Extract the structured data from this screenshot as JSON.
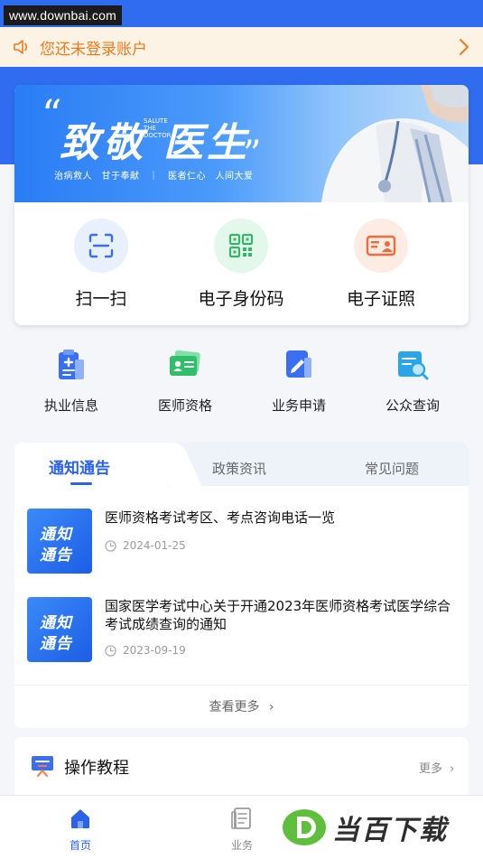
{
  "status": {
    "watermark": "www.downbai.com"
  },
  "login_bar": {
    "text": "您还未登录账户",
    "icon": "speaker-icon"
  },
  "banner": {
    "title_part1": "致敬",
    "title_part2": "医生",
    "open_quote": "“",
    "close_quote": "”",
    "vertical_text": "SALUTE THE DOCTOR",
    "subtitle": "治病救人　甘于奉献　｜　医者仁心　人间大爱"
  },
  "quick_actions": [
    {
      "label": "扫一扫",
      "icon": "scan-icon",
      "bg": "#e8f0fe",
      "color": "#3a6ff0"
    },
    {
      "label": "电子身份码",
      "icon": "qr-code-icon",
      "bg": "#e3f7ea",
      "color": "#35b46a"
    },
    {
      "label": "电子证照",
      "icon": "id-card-icon",
      "bg": "#fdece4",
      "color": "#f06a3a"
    }
  ],
  "functions": [
    {
      "label": "执业信息",
      "icon": "medical-record-icon"
    },
    {
      "label": "医师资格",
      "icon": "certificate-icon"
    },
    {
      "label": "业务申请",
      "icon": "application-icon"
    },
    {
      "label": "公众查询",
      "icon": "search-doc-icon"
    }
  ],
  "news": {
    "tabs": [
      "通知通告",
      "政策资讯",
      "常见问题"
    ],
    "thumb_line1": "通知",
    "thumb_line2": "通告",
    "items": [
      {
        "title": "医师资格考试考区、考点咨询电话一览",
        "date": "2024-01-25"
      },
      {
        "title": "国家医学考试中心关于开通2023年医师资格考试医学综合考试成绩查询的通知",
        "date": "2023-09-19"
      }
    ],
    "more": "查看更多"
  },
  "tutorial": {
    "title": "操作教程",
    "more": "更多"
  },
  "bottom_nav": [
    {
      "label": "首页",
      "icon": "home-icon",
      "active": true
    },
    {
      "label": "业务",
      "icon": "business-icon",
      "active": false
    }
  ],
  "watermark_bottom": {
    "text": "当百下载"
  },
  "colors": {
    "primary": "#2a62e8",
    "banner_blue": "#2f6cf0",
    "warning": "#ef7a1d"
  }
}
